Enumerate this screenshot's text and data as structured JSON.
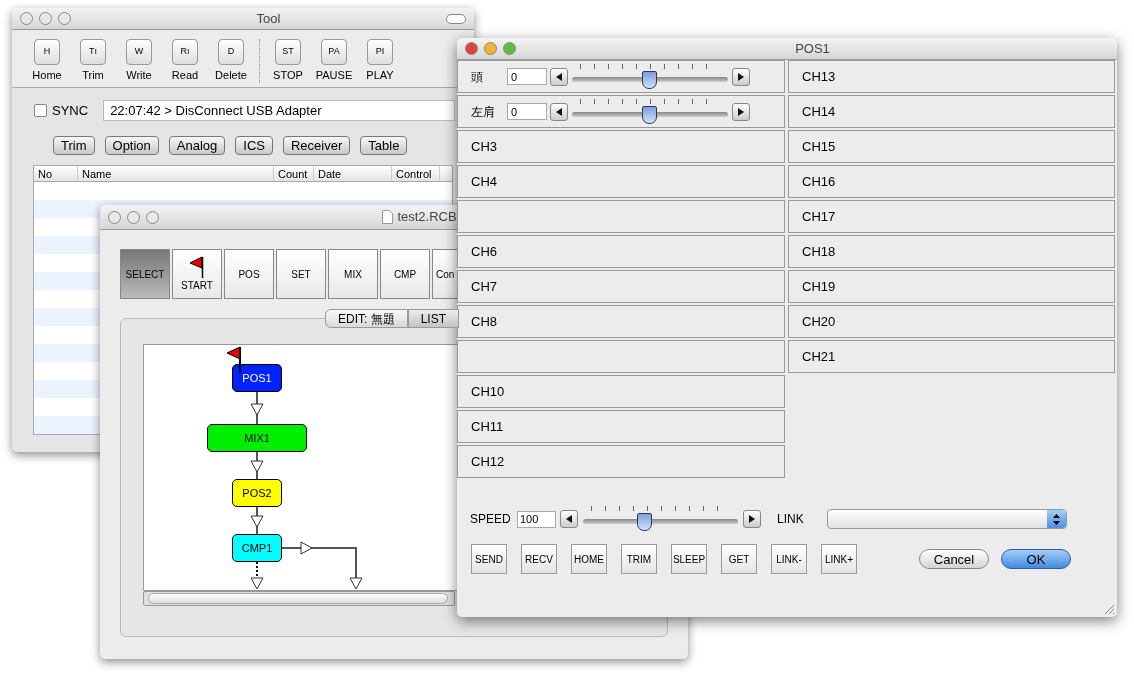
{
  "tool_window": {
    "title": "Tool",
    "toolbar": [
      {
        "icon_text": "H",
        "label": "Home"
      },
      {
        "icon_text": "Tı",
        "label": "Trim"
      },
      {
        "icon_text": "W",
        "label": "Write"
      },
      {
        "icon_text": "Rı",
        "label": "Read"
      },
      {
        "icon_text": "D",
        "label": "Delete"
      },
      {
        "icon_text": "ST",
        "label": "STOP"
      },
      {
        "icon_text": "PA",
        "label": "PAUSE"
      },
      {
        "icon_text": "PI",
        "label": "PLAY"
      }
    ],
    "sync": {
      "label": "SYNC",
      "checked": false
    },
    "status_field": {
      "value": "22:07:42 > DisConnect USB Adapter"
    },
    "buttons": [
      "Trim",
      "Option",
      "Analog",
      "ICS",
      "Receiver",
      "Table"
    ],
    "table": {
      "columns": [
        "No",
        "Name",
        "Count",
        "Date",
        "Control"
      ]
    }
  },
  "rcb_window": {
    "title": "test2.RCB",
    "toolbar": [
      {
        "label": "SELECT",
        "kind": "text",
        "selected": true
      },
      {
        "label": "START",
        "kind": "flag",
        "selected": false
      },
      {
        "label": "POS",
        "kind": "text",
        "selected": false
      },
      {
        "label": "SET",
        "kind": "text",
        "selected": false
      },
      {
        "label": "MIX",
        "kind": "text",
        "selected": false
      },
      {
        "label": "CMP",
        "kind": "text",
        "selected": false
      },
      {
        "label": "Con",
        "kind": "text",
        "selected": false
      }
    ],
    "tabs": [
      {
        "label": "EDIT: 無題",
        "selected": true
      },
      {
        "label": "LIST",
        "selected": false
      }
    ],
    "flow": {
      "nodes": [
        {
          "label": "POS1",
          "color": "#0022ff",
          "start": true
        },
        {
          "label": "MIX1",
          "color": "#00ee00",
          "start": false
        },
        {
          "label": "POS2",
          "color": "#ffff00",
          "start": false
        },
        {
          "label": "CMP1",
          "color": "#00ffff",
          "start": false
        }
      ]
    }
  },
  "pos_window": {
    "title": "POS1",
    "left_channels": [
      {
        "kind": "slider",
        "label": "頭",
        "value": "0",
        "level": 0.5
      },
      {
        "kind": "slider",
        "label": "左肩",
        "value": "0",
        "level": 0.5
      },
      {
        "kind": "label",
        "label": "CH3"
      },
      {
        "kind": "label",
        "label": "CH4"
      },
      {
        "kind": "empty"
      },
      {
        "kind": "label",
        "label": "CH6"
      },
      {
        "kind": "label",
        "label": "CH7"
      },
      {
        "kind": "label",
        "label": "CH8"
      },
      {
        "kind": "empty"
      },
      {
        "kind": "label",
        "label": "CH10"
      },
      {
        "kind": "label",
        "label": "CH11"
      },
      {
        "kind": "label",
        "label": "CH12"
      }
    ],
    "right_channels": [
      {
        "kind": "label",
        "label": "CH13"
      },
      {
        "kind": "label",
        "label": "CH14"
      },
      {
        "kind": "label",
        "label": "CH15"
      },
      {
        "kind": "label",
        "label": "CH16"
      },
      {
        "kind": "label",
        "label": "CH17"
      },
      {
        "kind": "label",
        "label": "CH18"
      },
      {
        "kind": "label",
        "label": "CH19"
      },
      {
        "kind": "label",
        "label": "CH20"
      },
      {
        "kind": "label",
        "label": "CH21"
      }
    ],
    "speed": {
      "label": "SPEED",
      "value": "100",
      "level": 0.4
    },
    "link": {
      "label": "LINK"
    },
    "commands": [
      "SEND",
      "RECV",
      "HOME",
      "TRIM",
      "SLEEP",
      "GET",
      "LINK-",
      "LINK+"
    ],
    "cancel": "Cancel",
    "ok": "OK"
  }
}
